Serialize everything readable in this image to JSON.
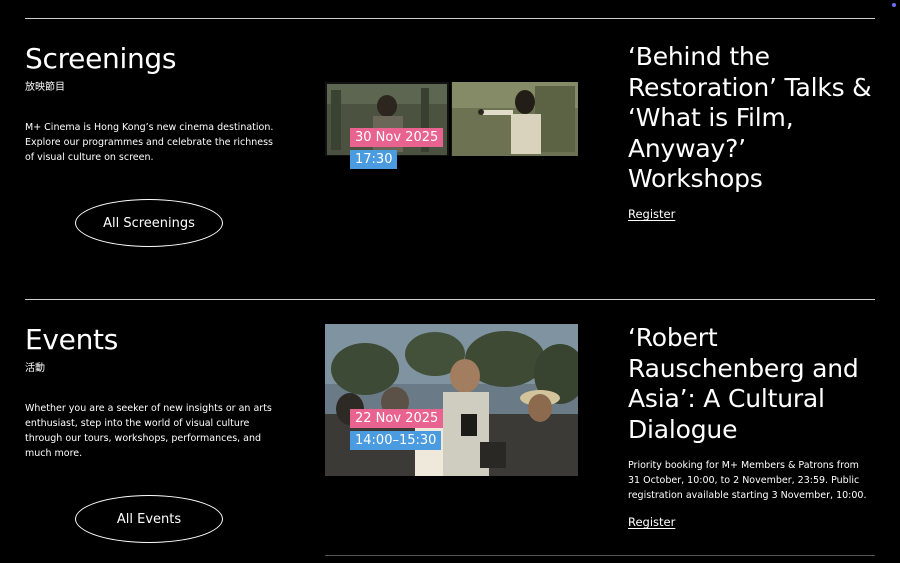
{
  "colors": {
    "background": "#000000",
    "date_tag": "#e8638f",
    "time_tag": "#4a9be0",
    "rule": "#cfcfcf"
  },
  "screenings": {
    "title": "Screenings",
    "subtitle": "放映節目",
    "description": "M+ Cinema is Hong Kong’s new cinema destination. Explore our programmes and celebrate the richness of visual culture on screen.",
    "button_label": "All Screenings",
    "featured": {
      "date": "30 Nov 2025",
      "time": "17:30",
      "title": "‘Behind the Restoration’ Talks & ‘What is Film, Anyway?’ Workshops",
      "link_label": "Register"
    }
  },
  "events": {
    "title": "Events",
    "subtitle": "活動",
    "description": "Whether you are a seeker of new insights or an arts enthusiast, step into the world of visual culture through our tours, workshops, performances, and much more.",
    "button_label": "All Events",
    "featured": {
      "date": "22 Nov 2025",
      "time": "14:00–15:30",
      "title": "‘Robert Rauschenberg and Asia’: A Cultural Dialogue",
      "note": "Priority booking for M+ Members & Patrons from 31 October, 10:00, to 2 November, 23:59. Public registration available starting 3 November, 10:00.",
      "link_label": "Register"
    }
  }
}
